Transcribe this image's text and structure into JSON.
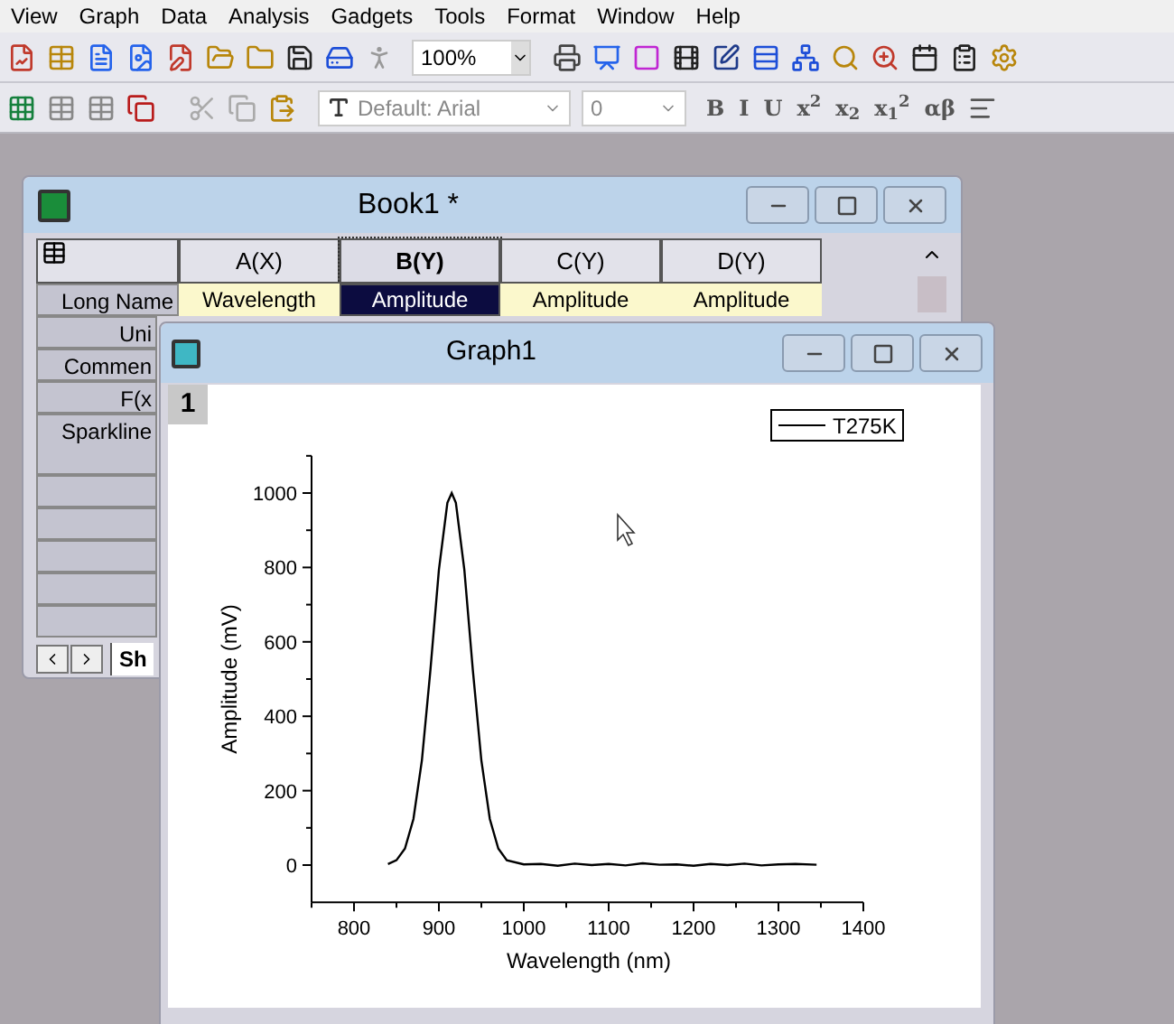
{
  "menu": [
    "View",
    "Graph",
    "Data",
    "Analysis",
    "Gadgets",
    "Tools",
    "Format",
    "Window",
    "Help"
  ],
  "toolbar": {
    "zoom": "100%",
    "font": "Default: Arial",
    "font_size": "0",
    "format_buttons": [
      "B",
      "I",
      "U",
      "x$^{2}$",
      "x$_{2}$",
      "x$_{1}$$^{2}$",
      "αβ"
    ]
  },
  "workbook": {
    "title": "Book1 *",
    "columns": [
      {
        "label": "A(X)",
        "long_name": "Wavelength",
        "selected": false
      },
      {
        "label": "B(Y)",
        "long_name": "Amplitude",
        "selected": true
      },
      {
        "label": "C(Y)",
        "long_name": "Amplitude",
        "selected": false
      },
      {
        "label": "D(Y)",
        "long_name": "Amplitude",
        "selected": false
      }
    ],
    "row_labels": [
      "Long Name",
      "Uni",
      "Commen",
      "F(x",
      "Sparkline"
    ],
    "sheet_tab": "Sh"
  },
  "graph": {
    "title": "Graph1",
    "layer": "1",
    "chart_data": {
      "type": "line",
      "xlabel": "Wavelength (nm)",
      "ylabel": "Amplitude (mV)",
      "x": [
        840,
        850,
        860,
        870,
        880,
        890,
        900,
        910,
        915,
        920,
        930,
        940,
        950,
        960,
        970,
        980,
        1000,
        1020,
        1040,
        1060,
        1080,
        1100,
        1120,
        1140,
        1160,
        1180,
        1200,
        1220,
        1240,
        1260,
        1280,
        1300,
        1320,
        1345
      ],
      "series": [
        {
          "name": "T275K",
          "color": "#000000",
          "values": [
            3,
            13,
            44,
            124,
            282,
            524,
            793,
            974,
            1000,
            974,
            793,
            524,
            282,
            124,
            44,
            13,
            2,
            3,
            -2,
            4,
            0,
            3,
            -1,
            5,
            1,
            2,
            -2,
            3,
            0,
            4,
            -1,
            2,
            3,
            1
          ]
        }
      ],
      "xlim": [
        750,
        1400
      ],
      "ylim": [
        -100,
        1100
      ],
      "xticks": [
        800,
        900,
        1000,
        1100,
        1200,
        1300,
        1400
      ],
      "yticks": [
        0,
        200,
        400,
        600,
        800,
        1000
      ]
    }
  }
}
